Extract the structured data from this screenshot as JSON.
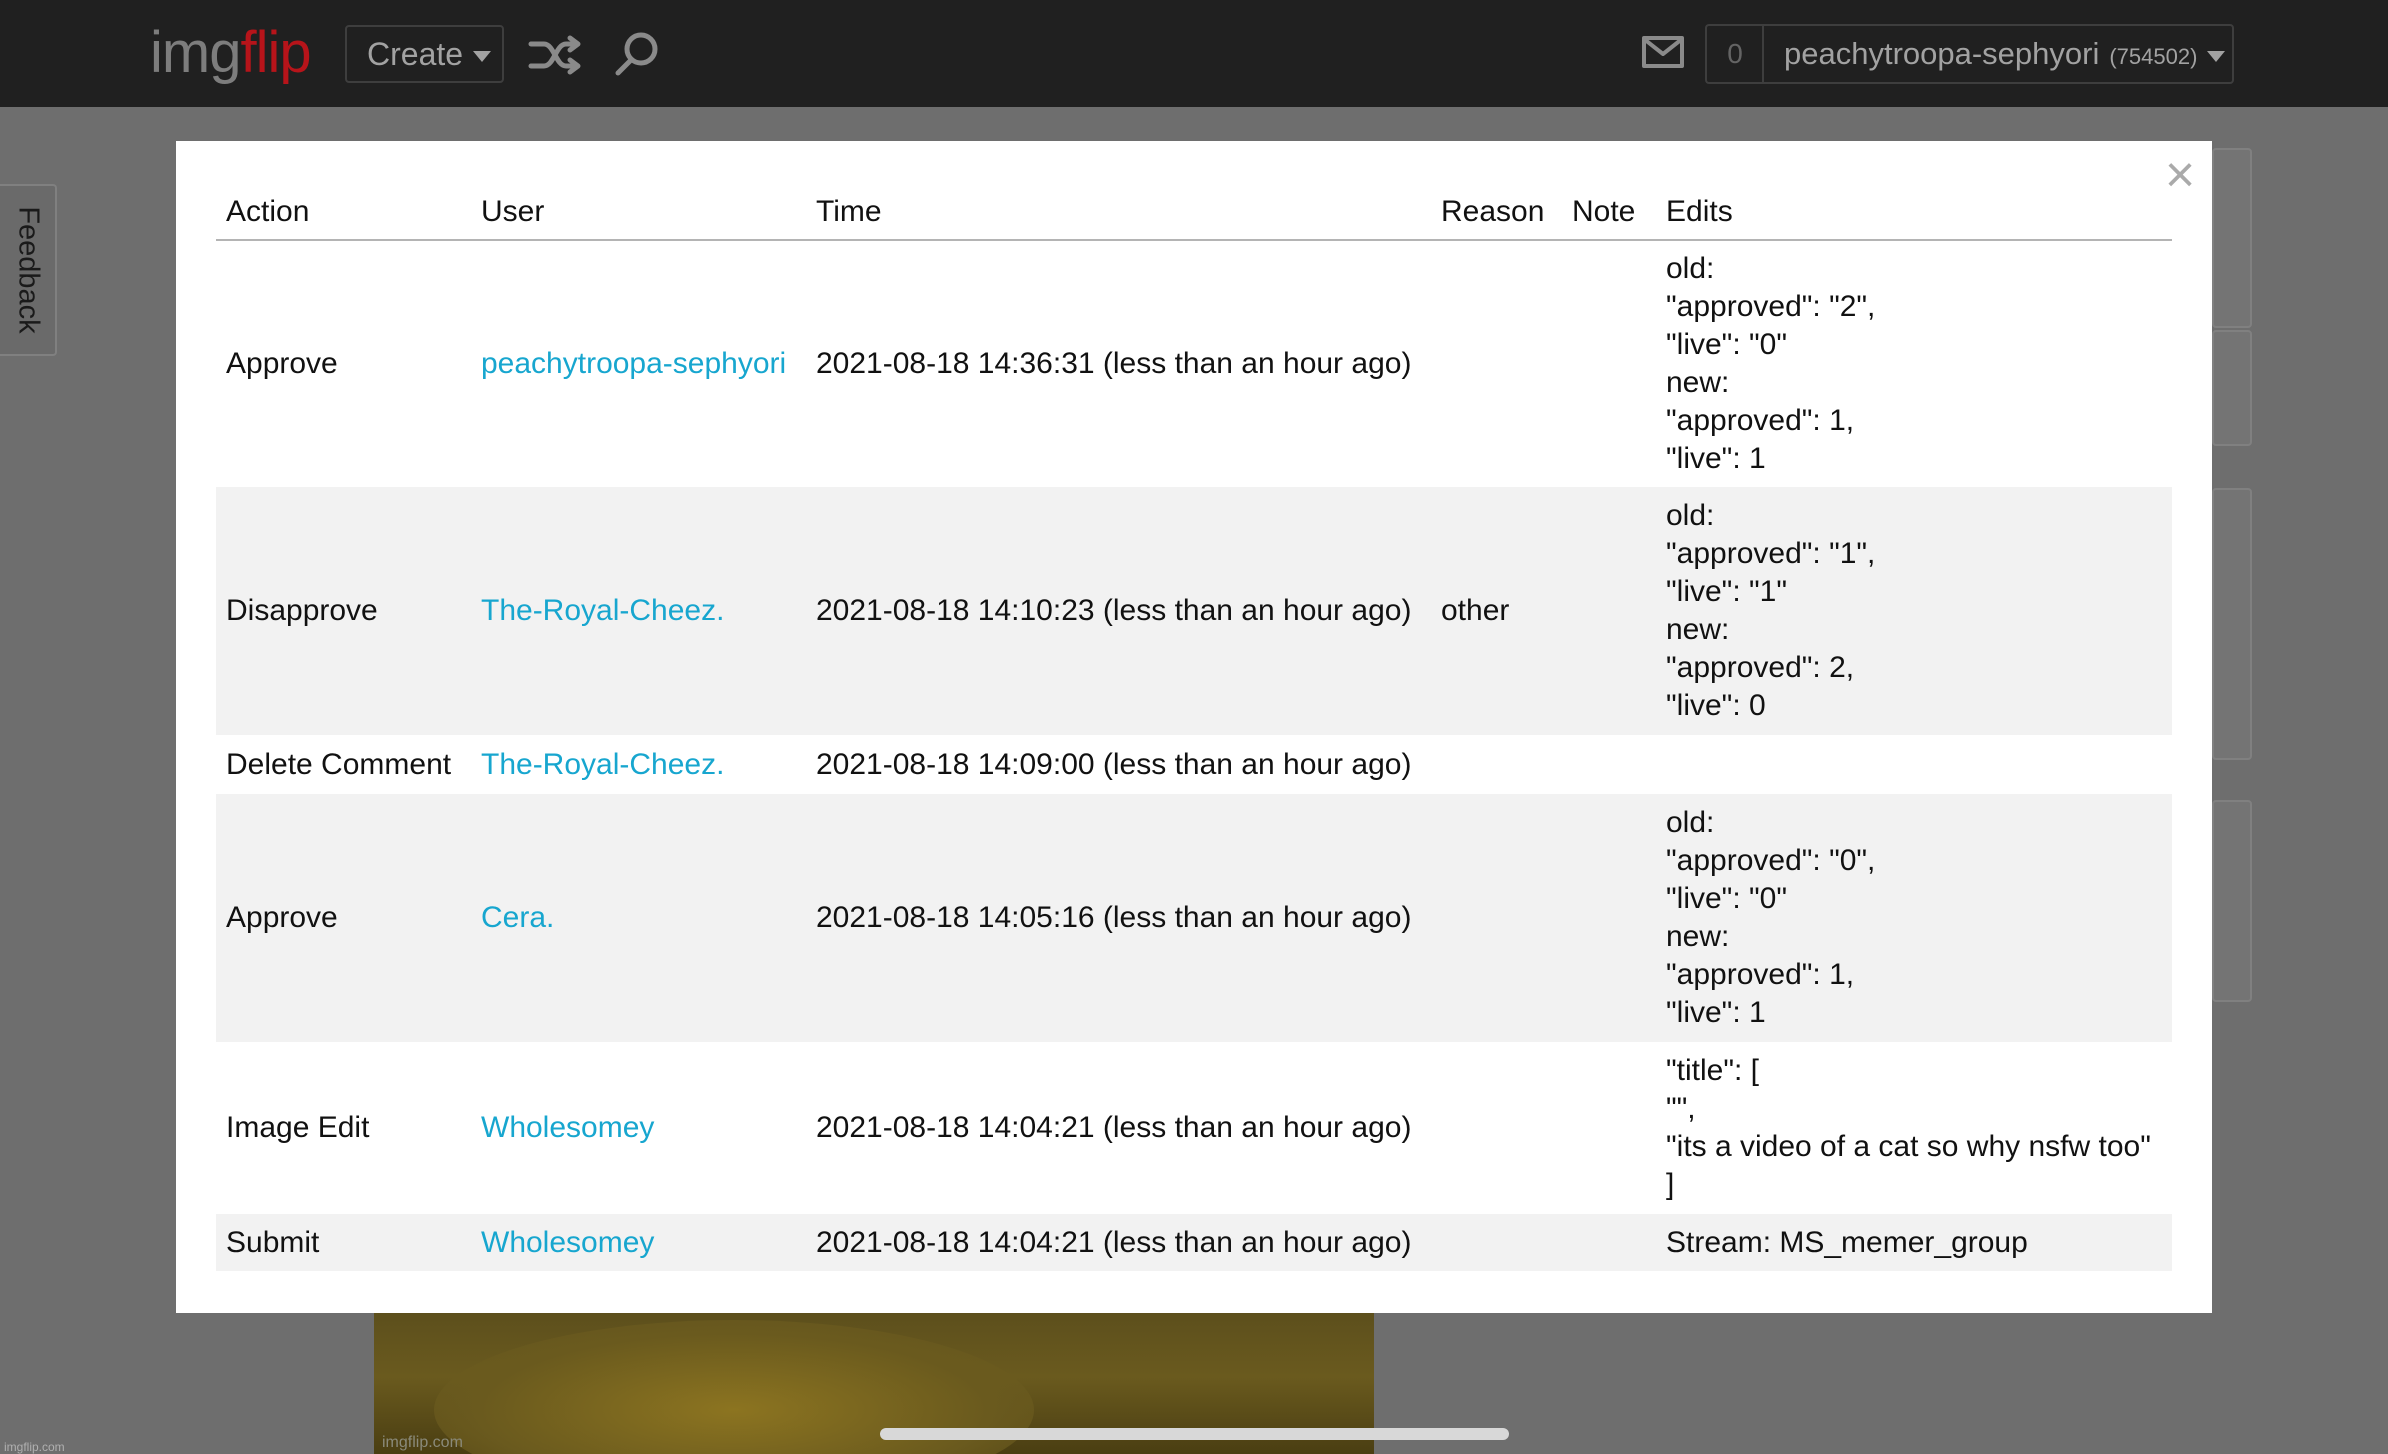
{
  "header": {
    "logo_img": "img",
    "logo_flip": "flip",
    "create_label": "Create",
    "shuffle_icon": "shuffle-icon",
    "search_icon": "search-icon",
    "mail_icon": "mail-icon",
    "notification_count": "0",
    "username": "peachytroopa-sephyori",
    "points": "(754502)"
  },
  "feedback_label": "Feedback",
  "modal": {
    "close_label": "×",
    "columns": [
      "Action",
      "User",
      "Time",
      "Reason",
      "Note",
      "Edits"
    ],
    "rows": [
      {
        "action": "Approve",
        "user": "peachytroopa-sephyori",
        "time": "2021-08-18 14:36:31 (less than an hour ago)",
        "reason": "",
        "note": "",
        "edits": [
          "old:",
          "\"approved\": \"2\",",
          "\"live\": \"0\"",
          "new:",
          "\"approved\": 1,",
          "\"live\": 1"
        ]
      },
      {
        "action": "Disapprove",
        "user": "The-Royal-Cheez.",
        "time": "2021-08-18 14:10:23 (less than an hour ago)",
        "reason": "other",
        "note": "",
        "edits": [
          "old:",
          "\"approved\": \"1\",",
          "\"live\": \"1\"",
          "new:",
          "\"approved\": 2,",
          "\"live\": 0"
        ]
      },
      {
        "action": "Delete Comment",
        "user": "The-Royal-Cheez.",
        "time": "2021-08-18 14:09:00 (less than an hour ago)",
        "reason": "",
        "note": "",
        "edits": []
      },
      {
        "action": "Approve",
        "user": "Cera.",
        "time": "2021-08-18 14:05:16 (less than an hour ago)",
        "reason": "",
        "note": "",
        "edits": [
          "old:",
          "\"approved\": \"0\",",
          "\"live\": \"0\"",
          "new:",
          "\"approved\": 1,",
          "\"live\": 1"
        ]
      },
      {
        "action": "Image Edit",
        "user": "Wholesomey",
        "time": "2021-08-18 14:04:21 (less than an hour ago)",
        "reason": "",
        "note": "",
        "edits": [
          "\"title\": [",
          "\"\",",
          "\"its a video of a cat so why nsfw too\"",
          "]"
        ]
      },
      {
        "action": "Submit",
        "user": "Wholesomey",
        "time": "2021-08-18 14:04:21 (less than an hour ago)",
        "reason": "",
        "note": "",
        "edits": [
          "Stream: MS_memer_group"
        ]
      }
    ]
  },
  "background": {
    "image_watermark": "imgflip.com",
    "footer_watermark": "imgflip.com"
  }
}
